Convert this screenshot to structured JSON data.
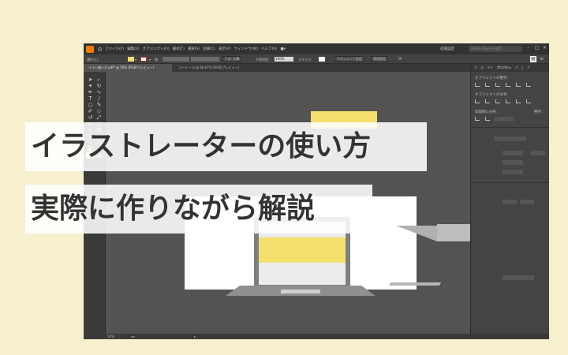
{
  "menubar": {
    "items": [
      "ファイル(F)",
      "編集(E)",
      "オブジェクト(O)",
      "書式(T)",
      "選択(S)",
      "効果(C)",
      "表示(V)",
      "ウィンドウ(W)",
      "ヘルプ(H)",
      "■▾"
    ],
    "workspace": "初期設定",
    "search_placeholder": "Adobe Stock を検索"
  },
  "controlbar": {
    "selection": "選択なし",
    "stroke_label": "線：",
    "brush": "3 pt. 丸筆",
    "opacity_label": "不透明度：",
    "opacity_value": "100%",
    "style_label": "スタイル：",
    "doc_setup": "ドキュメント設定",
    "prefs": "環境設定"
  },
  "tabs": [
    {
      "label": "イラレ使い方.pdf* @ 50% (RGB/プレビュー)",
      "active": true
    },
    {
      "label": "コーヒー.ai @ 66.67% (RGB/プレビュー)",
      "active": false
    }
  ],
  "panel": {
    "tabs": [
      "カ",
      "ス",
      "ライ",
      "プロパティ",
      "パ",
      "C",
      "ア"
    ],
    "active_tab": "プロパティ",
    "align_objects": "オブジェクトの整列：",
    "distribute_objects": "オブジェクトの分布：",
    "distribute_spacing": "等間隔に分布：",
    "align_to": "整列："
  },
  "status": {
    "zoom": "50%"
  },
  "title": {
    "line1": "イラストレーターの使い方",
    "line2": "実際に作りながら解説"
  },
  "colors": {
    "background": "#f7f0cf",
    "accent_yellow": "#f5e06e"
  }
}
